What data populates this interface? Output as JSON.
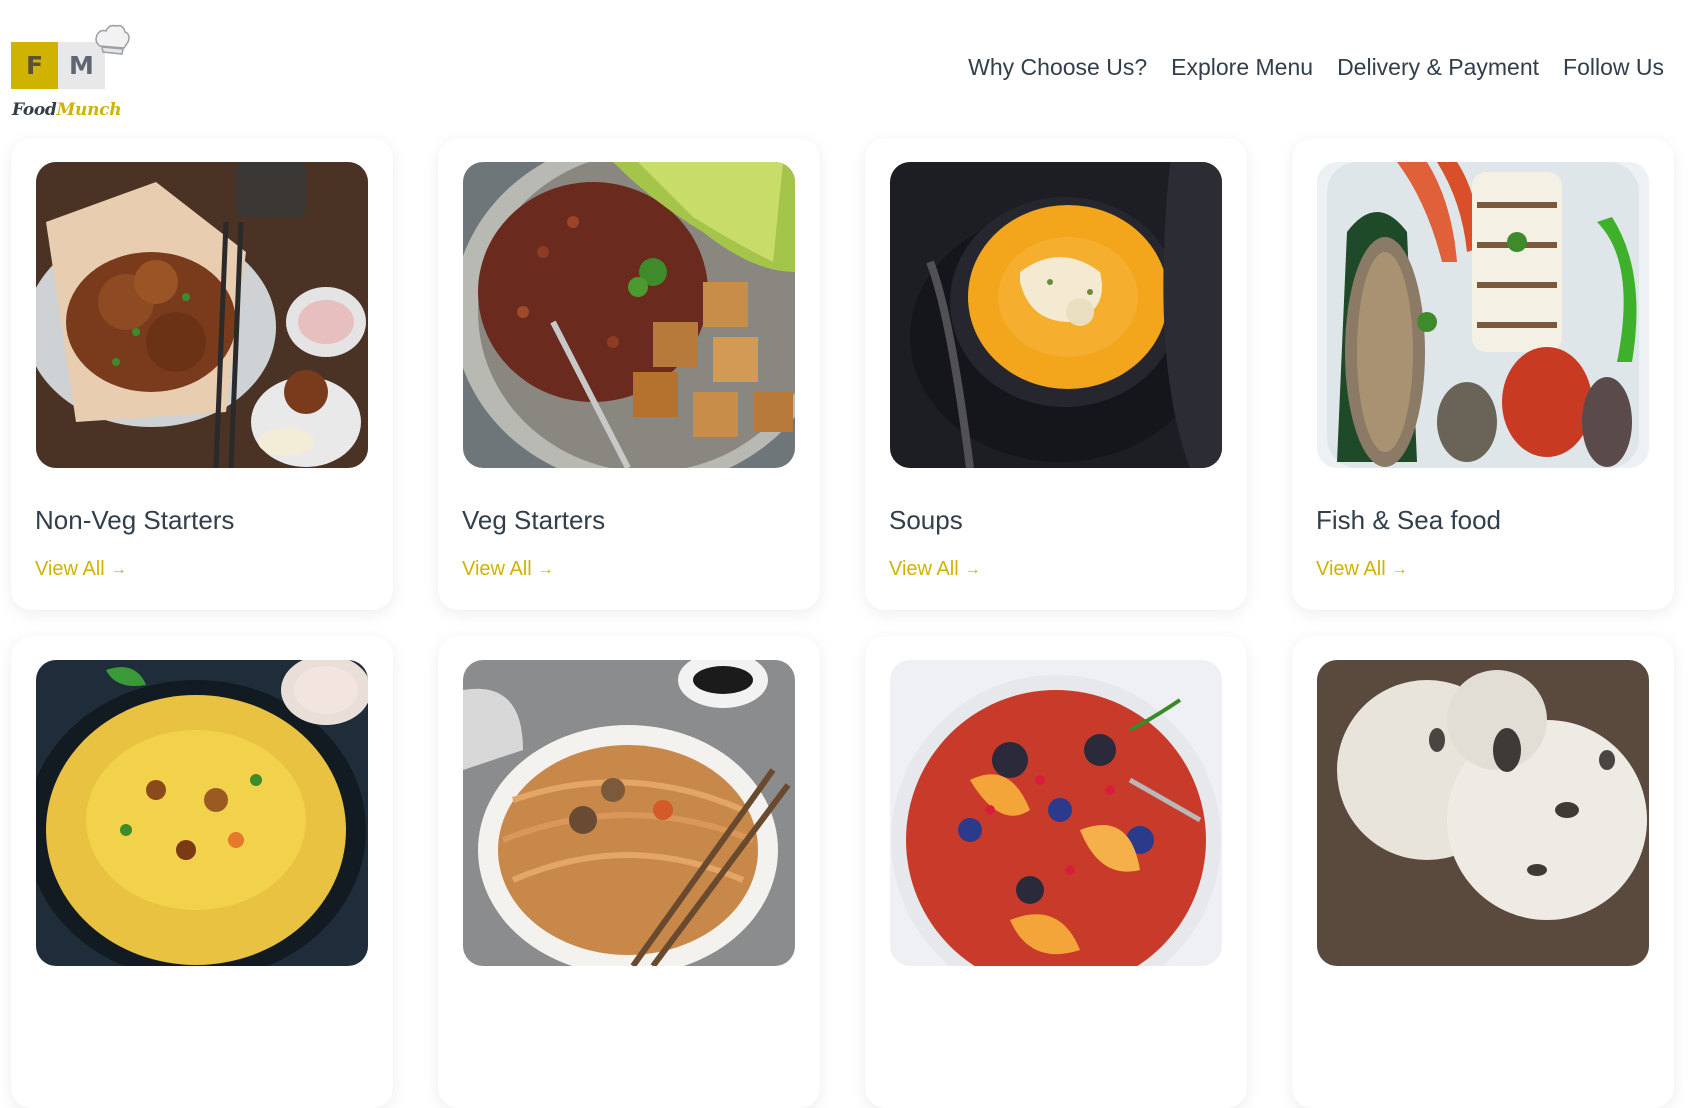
{
  "brand": {
    "part1": "Food",
    "part2": "Munch",
    "letter1": "F",
    "letter2": "M"
  },
  "nav": {
    "items": [
      {
        "label": "Why Choose Us?"
      },
      {
        "label": "Explore Menu"
      },
      {
        "label": "Delivery & Payment"
      },
      {
        "label": "Follow Us"
      }
    ]
  },
  "menu": {
    "link_label": "View All",
    "arrow_icon": "arrow-right-icon",
    "cards": [
      {
        "title": "Non-Veg Starters"
      },
      {
        "title": "Veg Starters"
      },
      {
        "title": "Soups"
      },
      {
        "title": "Fish & Sea food"
      },
      {
        "title": ""
      },
      {
        "title": ""
      },
      {
        "title": ""
      },
      {
        "title": ""
      }
    ]
  },
  "colors": {
    "accent": "#d0b200",
    "text": "#323f4b"
  }
}
